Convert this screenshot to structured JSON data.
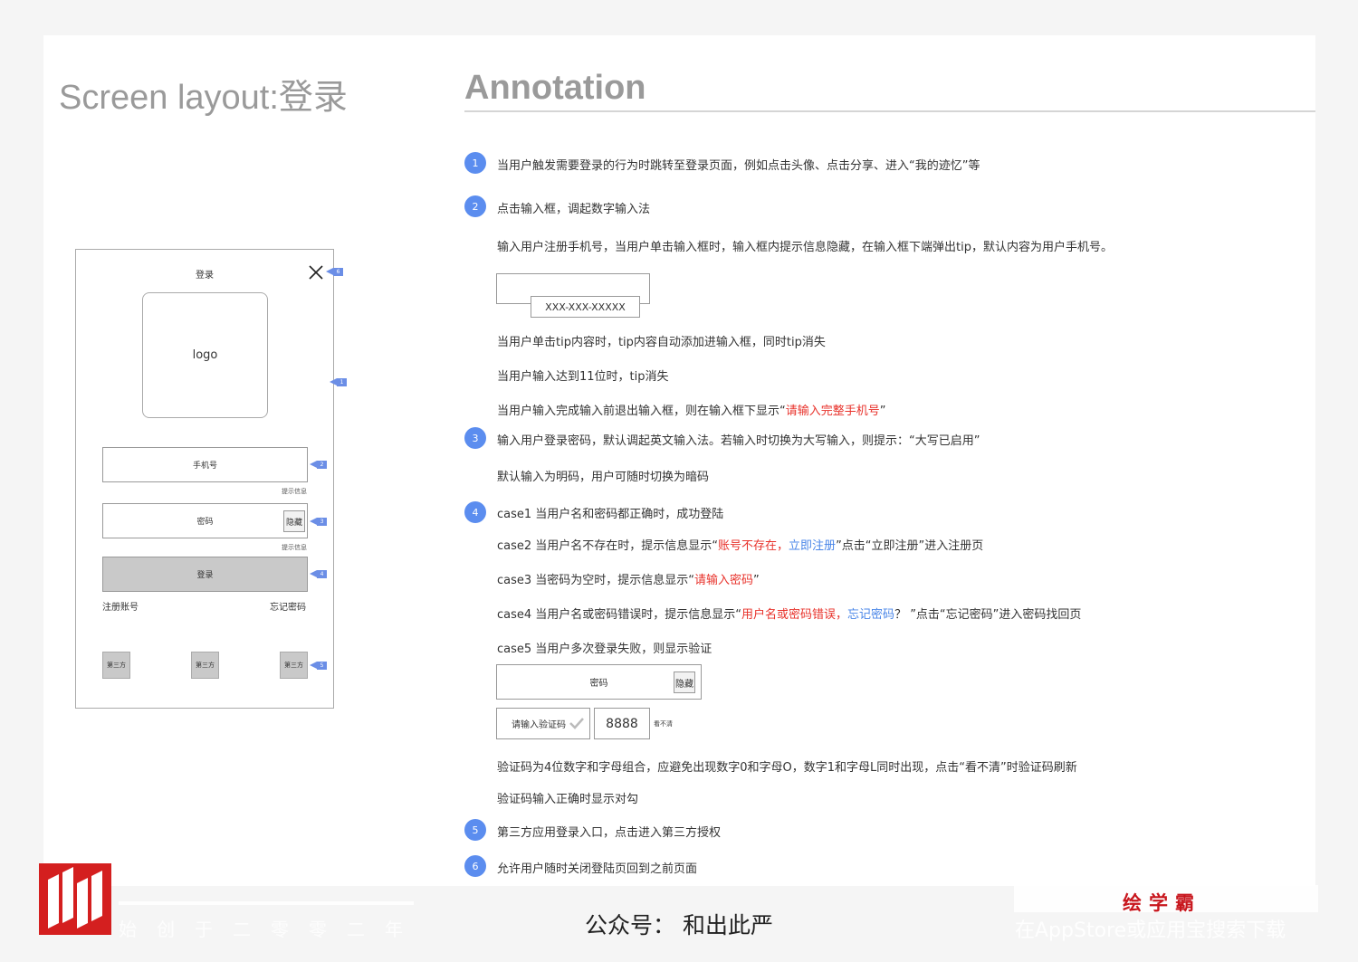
{
  "titles": {
    "left": "Screen layout:登录",
    "right": "Annotation"
  },
  "phone": {
    "title": "登录",
    "logo": "logo",
    "phone_field": "手机号",
    "phone_hint": "提示信息",
    "password_field": "密码",
    "hide_button": "隐藏",
    "password_hint": "提示信息",
    "login_button": "登录",
    "register_link": "注册账号",
    "forgot_link": "忘记密码",
    "third_party": [
      "第三方",
      "第三方",
      "第三方"
    ],
    "tags": [
      "1",
      "2",
      "3",
      "4",
      "5",
      "6"
    ],
    "tag_color": "#6b8ee6"
  },
  "annotation": {
    "badge_color": "#5b8def",
    "items": [
      {
        "num": "1",
        "text": "当用户触发需要登录的行为时跳转至登录页面，例如点击头像、点击分享、进入“我的迹忆”等"
      },
      {
        "num": "2",
        "text": "点击输入框，调起数字输入法"
      },
      {
        "num": "3",
        "text": "输入用户登录密码，默认调起英文输入法。若输入时切换为大写输入，则提示：“大写已启用”"
      },
      {
        "num": "4",
        "text": "case1 当用户名和密码都正确时，成功登陆"
      },
      {
        "num": "5",
        "text": "第三方应用登录入口，点击进入第三方授权"
      },
      {
        "num": "6",
        "text": "允许用户随时关闭登陆页回到之前页面"
      }
    ],
    "s2_line2": "输入用户注册手机号，当用户单击输入框时，输入框内提示信息隐藏，在输入框下端弹出tip，默认内容为用户手机号。",
    "tip_demo": "XXX-XXX-XXXXX",
    "s2_line3": "当用户单击tip内容时，tip内容自动添加进输入框，同时tip消失",
    "s2_line4": "当用户输入达到11位时，tip消失",
    "s2_line5_pre": "当用户输入完成输入前退出输入框，则在输入框下显示“",
    "s2_line5_red": "请输入完整手机号",
    "s2_line5_post": "”",
    "s3_line2": "默认输入为明码，用户可随时切换为暗码",
    "case2_pre": "case2 当用户名不存在时，提示信息显示“",
    "case2_red": "账号不存在，",
    "case2_blue": "立即注册",
    "case2_post": "”点击“立即注册”进入注册页",
    "case3_pre": "case3 当密码为空时，提示信息显示“",
    "case3_red": "请输入密码",
    "case3_post": "”",
    "case4_pre": "case4 当用户名或密码错误时，提示信息显示“",
    "case4_red": "用户名或密码错误，",
    "case4_blue": "忘记密码",
    "case4_post": "？ ”点击“忘记密码”进入密码找回页",
    "case5": "case5 当用户多次登录失败，则显示验证",
    "captcha_password": "密码",
    "captcha_hide": "隐藏",
    "captcha_input": "请输入验证码",
    "captcha_code": "8888",
    "captcha_refresh": "看不清",
    "captcha_rule": "验证码为4位数字和字母组合，应避免出现数字0和字母O，数字1和字母L同时出现，点击“看不清”时验证码刷新",
    "captcha_ok": "验证码输入正确时显示对勾"
  },
  "footer": {
    "tagline": "始创于二零零二年",
    "official_account": "公众号：  和出此严",
    "brand": "绘学霸",
    "search_hint": "在AppStore或应用宝搜索下载",
    "brand_color": "#d41f1f"
  }
}
